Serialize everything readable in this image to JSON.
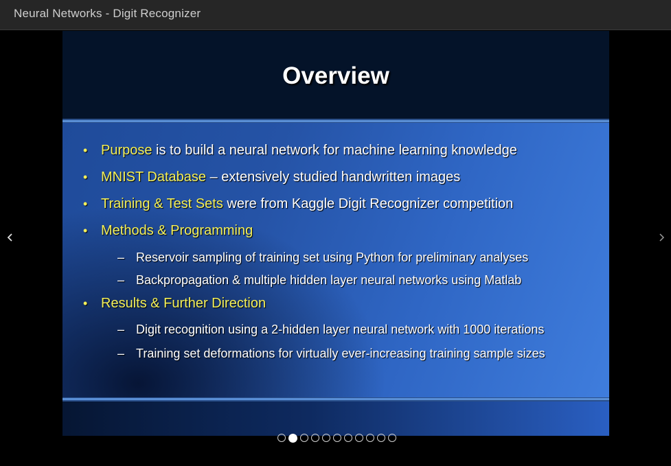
{
  "window": {
    "title": "Neural Networks - Digit Recognizer"
  },
  "slide": {
    "title": "Overview",
    "bullets": [
      {
        "highlight": "Purpose",
        "text": " is to build a neural network for machine learning knowledge"
      },
      {
        "highlight": "MNIST Database",
        "text": " – extensively studied handwritten images"
      },
      {
        "highlight": "Training & Test Sets",
        "text": " were from Kaggle Digit Recognizer competition"
      },
      {
        "highlight": "Methods & Programming",
        "text": ""
      },
      {
        "highlight": "Results & Further Direction",
        "text": ""
      }
    ],
    "sub_bullets": [
      "Reservoir sampling of training set using Python for preliminary analyses",
      "Backpropagation & multiple hidden layer neural networks using Matlab",
      "Digit recognition using a 2-hidden layer neural network with 1000 iterations",
      "Training set deformations for virtually ever-increasing training sample sizes"
    ],
    "bullet_glyph": "•",
    "dash_glyph": "–"
  },
  "pager": {
    "total": 11,
    "current": 2
  },
  "icons": {
    "prev": "chevron-left-icon",
    "next": "chevron-right-icon"
  },
  "colors": {
    "highlight": "#f4f05a",
    "slide_bg": "#2553a6",
    "titlebar": "#262626"
  }
}
